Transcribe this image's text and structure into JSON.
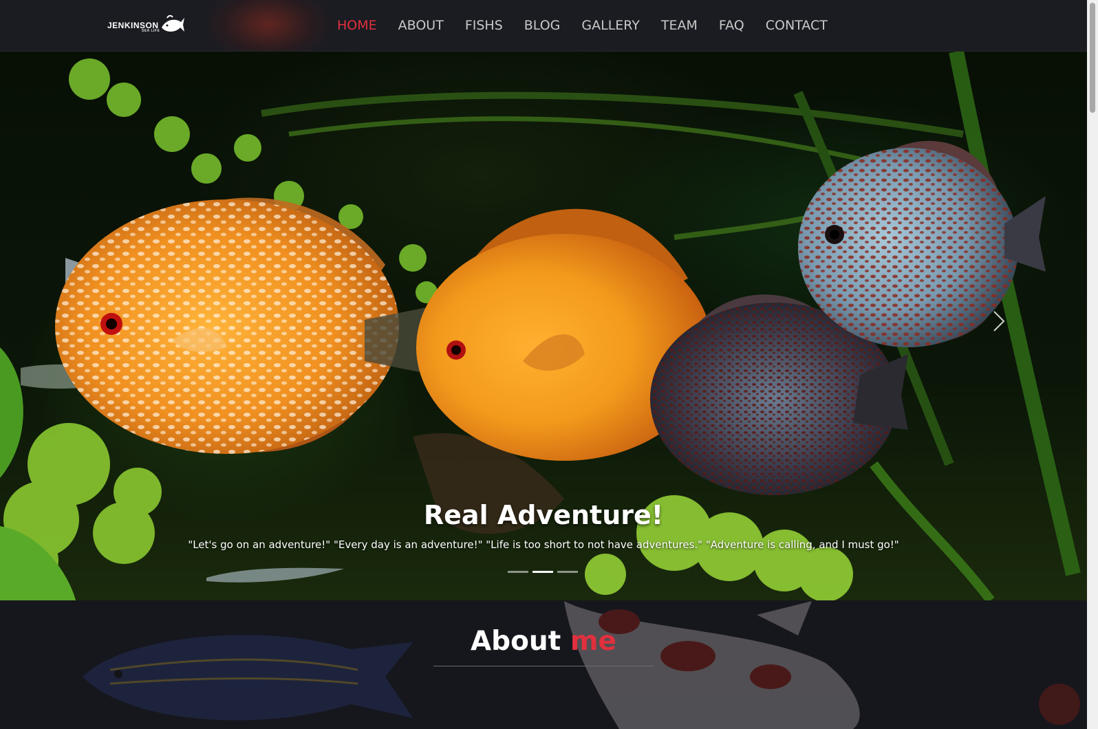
{
  "brand": {
    "name": "JENKINSON",
    "tagline": "SEA LIFE"
  },
  "nav": {
    "items": [
      {
        "label": "HOME",
        "active": true
      },
      {
        "label": "ABOUT",
        "active": false
      },
      {
        "label": "FISHS",
        "active": false
      },
      {
        "label": "BLOG",
        "active": false
      },
      {
        "label": "GALLERY",
        "active": false
      },
      {
        "label": "TEAM",
        "active": false
      },
      {
        "label": "FAQ",
        "active": false
      },
      {
        "label": "CONTACT",
        "active": false
      }
    ]
  },
  "hero": {
    "title": "Real Adventure!",
    "caption": "\"Let's go on an adventure!\" \"Every day is an adventure!\" \"Life is too short to not have adventures.\" \"Adventure is calling, and I must go!\"",
    "slide_count": 3,
    "active_slide": 2,
    "next_icon": "chevron-right-icon"
  },
  "about": {
    "title_main": "About",
    "title_accent": "me"
  },
  "colors": {
    "accent": "#e0303e",
    "nav_text": "#c9c9c9",
    "background": "#15161c"
  }
}
